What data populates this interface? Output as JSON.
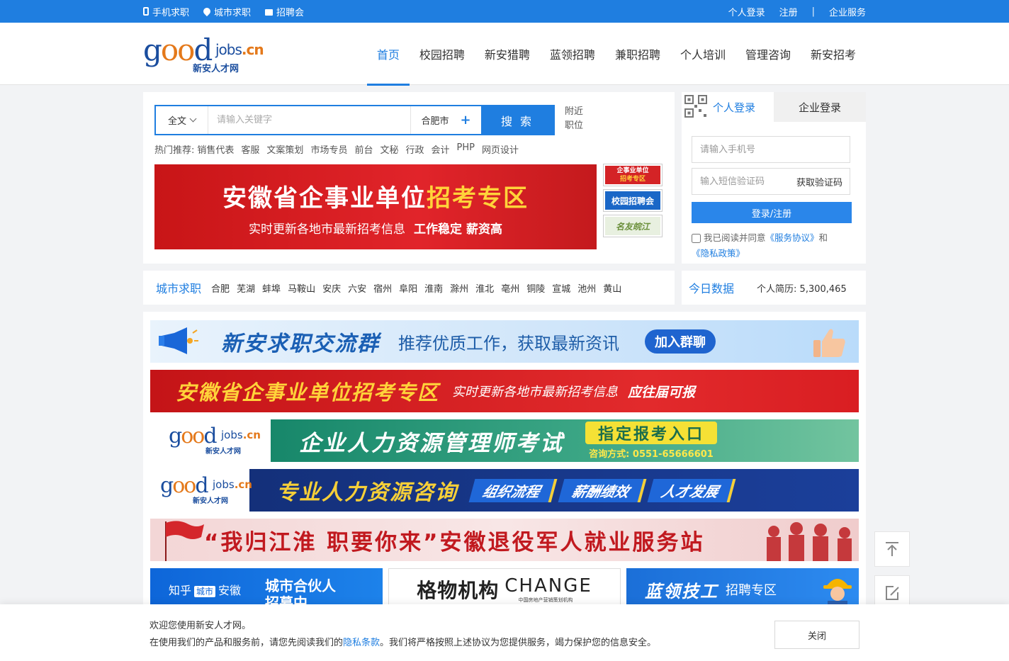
{
  "topbar": {
    "left": [
      {
        "icon": "phone-icon",
        "label": "手机求职"
      },
      {
        "icon": "location-pin-icon",
        "label": "城市求职"
      },
      {
        "icon": "briefcase-icon",
        "label": "招聘会"
      }
    ],
    "right": {
      "login": "个人登录",
      "register": "注册",
      "separator": "|",
      "enterprise": "企业服务"
    }
  },
  "logo": {
    "good_g": "g",
    "good_oo": "oo",
    "good_d": "d",
    "jobs": "jobs",
    "cn": ".cn",
    "subtitle": "新安人才网"
  },
  "nav": [
    "首页",
    "校园招聘",
    "新安猎聘",
    "蓝领招聘",
    "兼职招聘",
    "个人培训",
    "管理咨询",
    "新安招考"
  ],
  "search": {
    "type": "全文",
    "placeholder": "请输入关键字",
    "city": "合肥市",
    "plus": "+",
    "button": "搜 索",
    "nearby_1": "附近",
    "nearby_2": "职位"
  },
  "hot": {
    "label": "热门推荐:",
    "items": [
      "销售代表",
      "客服",
      "文案策划",
      "市场专员",
      "前台",
      "文秘",
      "行政",
      "会计",
      "PHP",
      "网页设计"
    ]
  },
  "main_banner": {
    "title_a": "安徽省企事业单位",
    "title_b": "招考专区",
    "sub": "实时更新各地市最新招考信息",
    "sub_bold": "工作稳定 薪资高"
  },
  "side_badges": {
    "b1_line1": "企事业单位",
    "b1_line2": "招考专区",
    "b2": "校园招聘会",
    "b3": "名友皖江"
  },
  "login": {
    "tab_personal": "个人登录",
    "tab_company": "企业登录",
    "phone_placeholder": "请输入手机号",
    "code_placeholder": "输入短信验证码",
    "get_code": "获取验证码",
    "button": "登录/注册",
    "agree_prefix": "我已阅读并同意",
    "service": "《服务协议》",
    "and": "和",
    "privacy": "《隐私政策》"
  },
  "city_row": {
    "title": "城市求职",
    "cities": [
      "合肥",
      "芜湖",
      "蚌埠",
      "马鞍山",
      "安庆",
      "六安",
      "宿州",
      "阜阳",
      "淮南",
      "滁州",
      "淮北",
      "亳州",
      "铜陵",
      "宣城",
      "池州",
      "黄山"
    ]
  },
  "today": {
    "title": "今日数据",
    "label": "个人简历:",
    "value": "5,300,465"
  },
  "banners": {
    "b1": {
      "title": "新安求职交流群",
      "sub": "推荐优质工作，获取最新资讯",
      "btn": "加入群聊"
    },
    "b2": {
      "title_a": "安徽省企事业单位",
      "title_b": "招考专区",
      "sub": "实时更新各地市最新招考信息",
      "tail": "应往届可报"
    },
    "b3": {
      "title": "企业人力资源管理师考试",
      "btn": "指定报考入口",
      "phone": "咨询方式: 0551-65666601"
    },
    "b4": {
      "title": "专业人力资源咨询",
      "tags": [
        "组织流程",
        "薪酬绩效",
        "人才发展"
      ]
    },
    "b5": {
      "title": "“我归江淮 职要你来”安徽退役军人就业服务站"
    },
    "s1": {
      "a1": "知乎",
      "a2": "城市",
      "a3": "安徽",
      "b1": "城市合伙人",
      "b2": "招募中…"
    },
    "s2": {
      "a": "格物机构",
      "b": "CHANGE",
      "small": "中国房地产营销策划机构"
    },
    "s3": {
      "a": "蓝领技工",
      "b": "招聘专区"
    }
  },
  "cookie": {
    "line1": "欢迎您使用新安人才网。",
    "line2_a": "在使用我们的产品和服务前，请您先阅读我们的",
    "line2_link": "隐私条款",
    "line2_b": "。我们将严格按照上述协议为您提供服务，竭力保护您的信息安全。",
    "close": "关闭"
  }
}
